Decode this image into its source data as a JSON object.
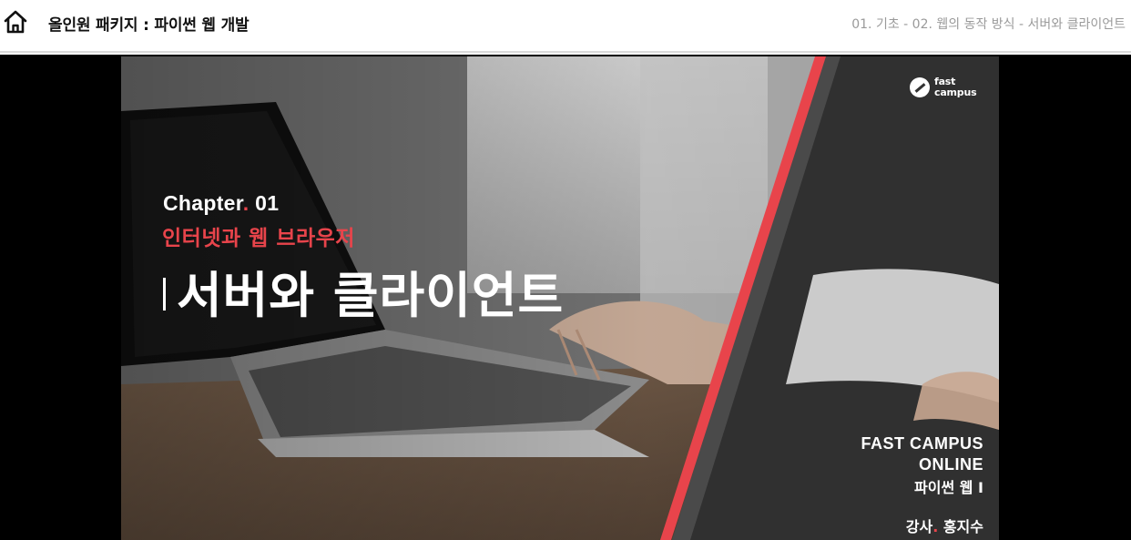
{
  "header": {
    "home_icon": "home-icon",
    "course_title": "올인원 패키지 : 파이썬 웹 개발",
    "breadcrumb": "01. 기초 - 02. 웹의 동작 방식 - 서버와 클라이언트"
  },
  "video": {
    "logo_line1": "fast",
    "logo_line2": "campus",
    "chapter_label": "Chapter",
    "chapter_dot": ".",
    "chapter_number": " 01",
    "chapter_subtitle": "인터넷과 웹 브라우저",
    "lecture_title": "서버와 클라이언트",
    "credit_line1": "FAST CAMPUS",
    "credit_line2": "ONLINE",
    "credit_line3": "파이썬 웹 I",
    "instructor_label": "강사",
    "instructor_dot": ".",
    "instructor_name": " 홍지수"
  },
  "colors": {
    "accent_red": "#e8444b",
    "player_bg": "#000000",
    "header_bg": "#ffffff"
  }
}
